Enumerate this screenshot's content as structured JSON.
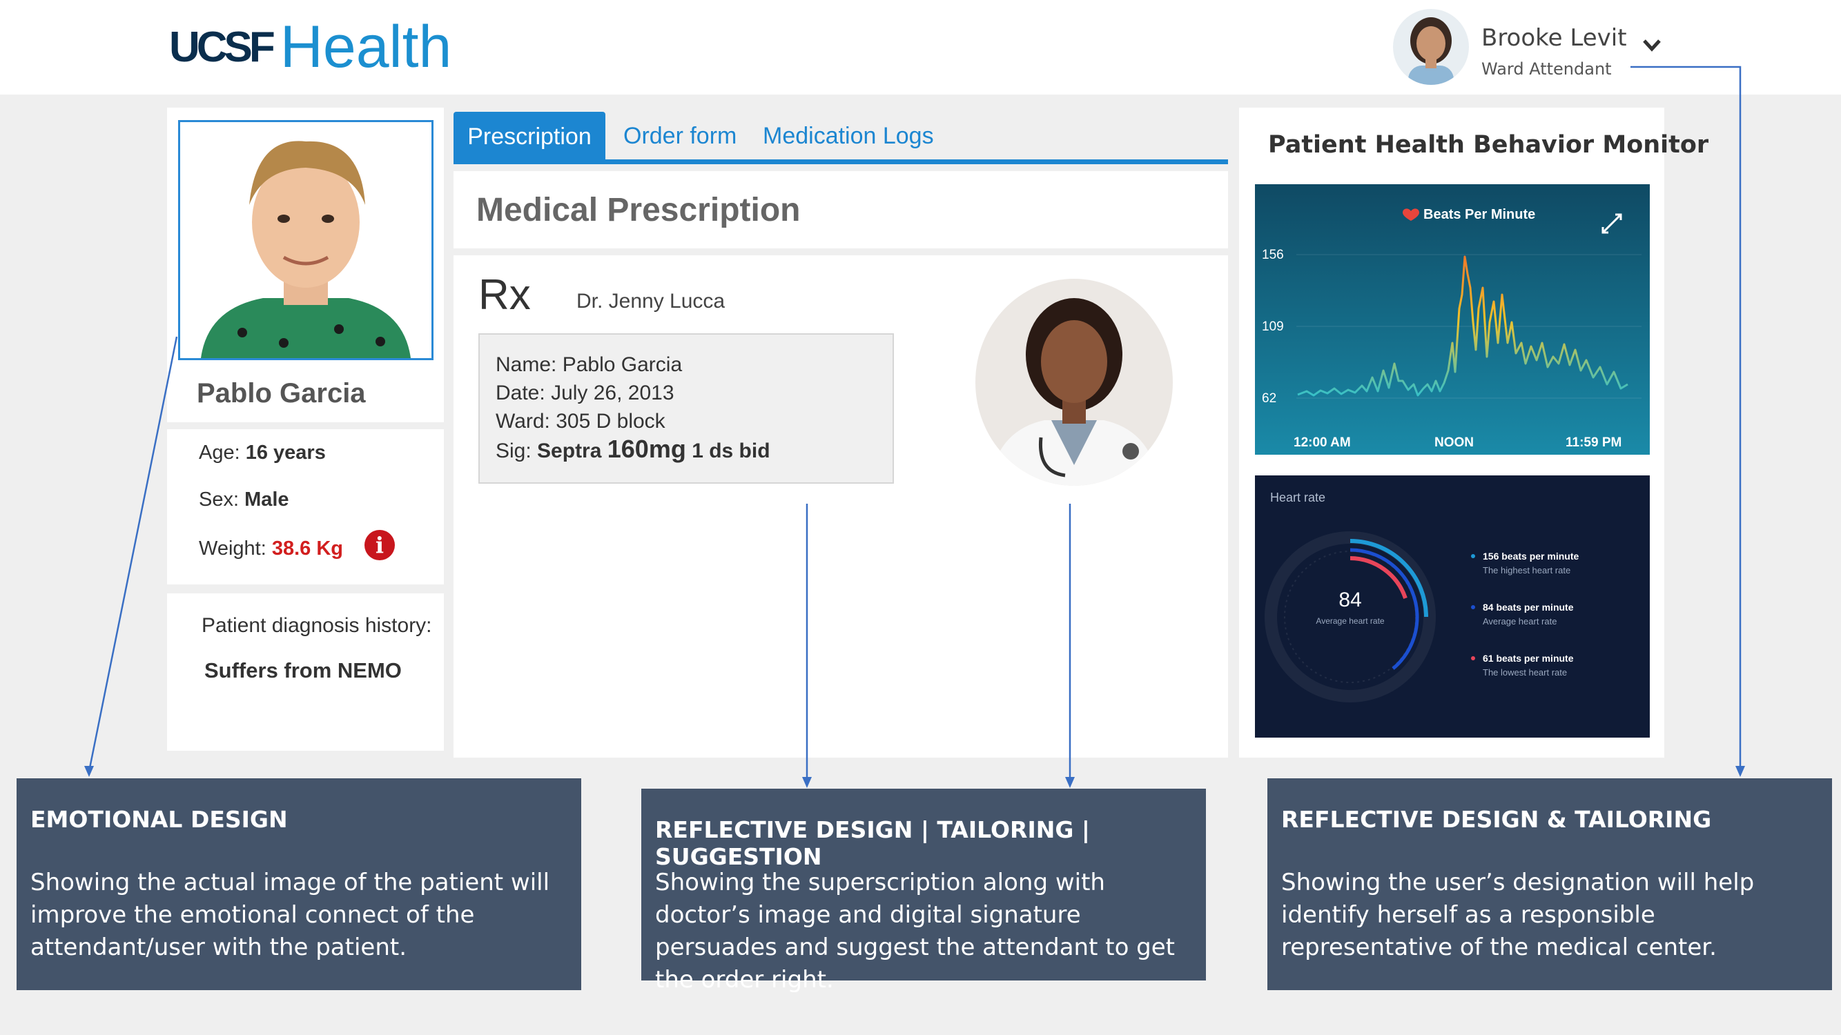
{
  "brand": {
    "logo_part1": "UCSF",
    "logo_part2": "Health",
    "primary_color": "#1c86d1",
    "logo_dark": "#0a2e4d"
  },
  "user": {
    "name": "Brooke Levit",
    "role": "Ward Attendant",
    "menu_icon": "chevron-down-icon"
  },
  "patient": {
    "name": "Pablo Garcia",
    "age_label": "Age:",
    "age_value": "16 years",
    "sex_label": "Sex:",
    "sex_value": "Male",
    "weight_label": "Weight:",
    "weight_value": "38.6 Kg",
    "weight_color": "#d21f1f",
    "alert_icon": "info-icon",
    "diagnosis_label": "Patient diagnosis history:",
    "diagnosis_value": "Suffers from NEMO"
  },
  "tabs": [
    {
      "label": "Prescription",
      "active": true
    },
    {
      "label": "Order form",
      "active": false
    },
    {
      "label": "Medication Logs",
      "active": false
    }
  ],
  "prescription": {
    "title": "Medical Prescription",
    "rx_symbol": "Rx",
    "doctor": "Dr. Jenny Lucca",
    "name_label": "Name:",
    "name_value": "Pablo Garcia",
    "date_label": "Date:",
    "date_value": "July 26, 2013",
    "ward_label": "Ward:",
    "ward_value": "305 D block",
    "sig_label": "Sig:",
    "sig_drug": "Septra",
    "sig_dose": "160mg",
    "sig_freq": "1 ds bid"
  },
  "monitor": {
    "title": "Patient Health Behavior Monitor",
    "bpm_chart": {
      "label": "Beats Per Minute",
      "y_ticks": [
        "156",
        "109",
        "62"
      ],
      "x_ticks": [
        "12:00 AM",
        "NOON",
        "11:59 PM"
      ]
    },
    "heart_rate": {
      "label": "Heart rate",
      "average_value": "84",
      "average_caption": "Average heart rate",
      "legend": [
        {
          "value": "156 beats per minute",
          "caption": "The highest heart rate"
        },
        {
          "value": "84 beats per minute",
          "caption": "Average heart rate"
        },
        {
          "value": "61 beats per minute",
          "caption": "The lowest heart rate"
        }
      ]
    }
  },
  "notes": [
    {
      "title": "EMOTIONAL DESIGN",
      "body": "Showing the actual image of the patient will improve the emotional connect of the attendant/user with the patient."
    },
    {
      "title": "REFLECTIVE DESIGN | TAILORING | SUGGESTION",
      "body": "Showing the superscription along with doctor’s image and digital signature persuades and suggest the attendant to get the order right."
    },
    {
      "title": "REFLECTIVE DESIGN & TAILORING",
      "body": "Showing the user’s designation will help identify herself as a responsible representative of the medical center."
    }
  ],
  "note_color": "#44546a"
}
